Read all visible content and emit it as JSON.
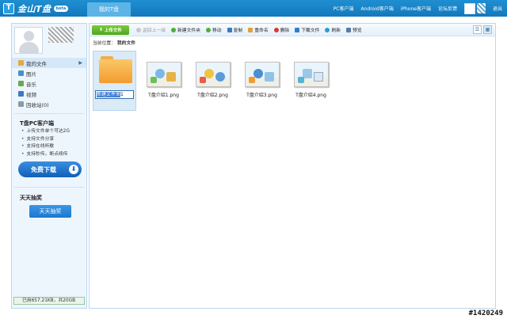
{
  "header": {
    "logo_letter": "T",
    "logo_text": "金山T盘",
    "logo_badge": "beta",
    "current_tab": "我的T盘",
    "links": [
      "PC客户端",
      "Android客户端",
      "iPhone客户端",
      "论坛反馈"
    ],
    "logout": "退出"
  },
  "sidebar": {
    "nav": [
      {
        "label": "我的文件",
        "icon": "my-files-icon",
        "color": "#e8a93a"
      },
      {
        "label": "图片",
        "icon": "picture-icon",
        "color": "#4a8fd0"
      },
      {
        "label": "音乐",
        "icon": "music-icon",
        "color": "#6aa84f"
      },
      {
        "label": "视频",
        "icon": "video-icon",
        "color": "#3a7ac0"
      },
      {
        "label": "回收站(0)",
        "icon": "recycle-bin-icon",
        "color": "#8a9aa8"
      }
    ],
    "pc_client": {
      "title": "T盘PC客户端",
      "features": [
        "上传文件单个可达2G",
        "支持文件分享",
        "支持在线听歌",
        "支持秒传，断点续传"
      ],
      "download_label": "免费下载"
    },
    "lottery": {
      "title": "天天抽奖",
      "button_label": "天天抽奖"
    },
    "storage_text": "已用657.21KB，共20GB"
  },
  "toolbar": {
    "upload_label": "上传文件",
    "back_label": "返回上一级",
    "new_folder_label": "新建文件夹",
    "move_label": "移动",
    "copy_label": "复制",
    "rename_label": "重命名",
    "delete_label": "删除",
    "download_label": "下载文件",
    "refresh_label": "刷新",
    "preview_label": "预览"
  },
  "breadcrumb": {
    "prefix": "当前位置：",
    "current": "我的文件"
  },
  "files": [
    {
      "name": "新建文件夹",
      "suffix": "1",
      "type": "folder",
      "editing": true
    },
    {
      "name": "T盘介绍1.png",
      "type": "image"
    },
    {
      "name": "T盘介绍2.png",
      "type": "image"
    },
    {
      "name": "T盘介绍3.png",
      "type": "image"
    },
    {
      "name": "T盘介绍4.png",
      "type": "image"
    }
  ],
  "watermark": "#1420249"
}
